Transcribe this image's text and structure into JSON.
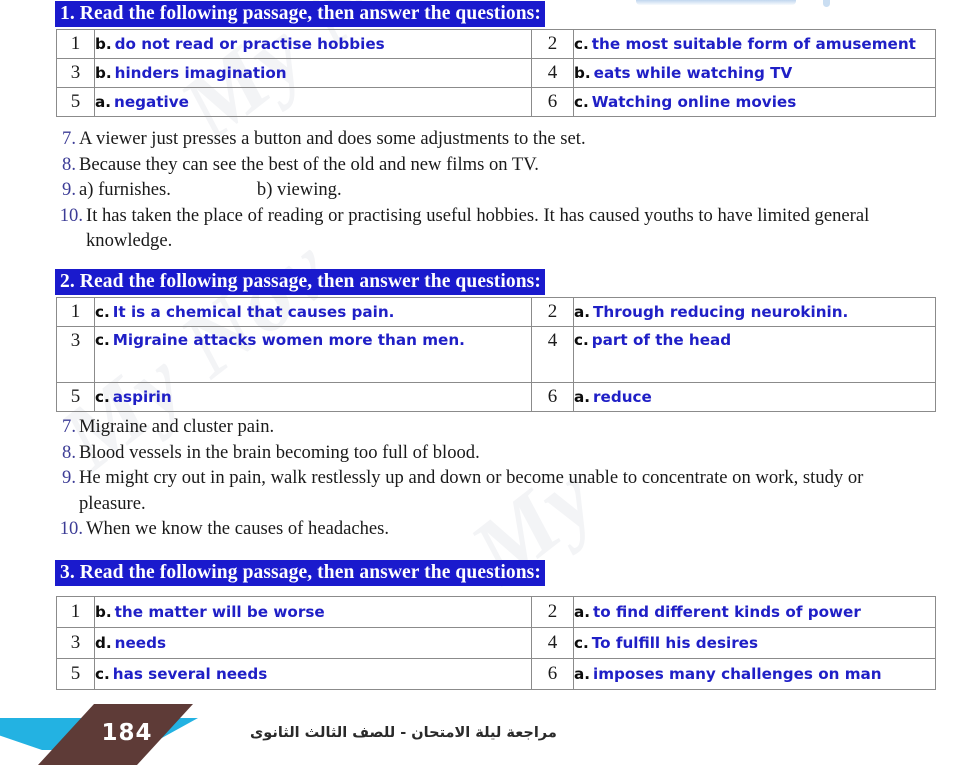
{
  "page": {
    "number": "184",
    "footer_arabic": "مراجعة ليلة الامتحان - للصف الثالث الثانوى",
    "accent_blue": "#1a1acd",
    "answer_blue": "#1f1fc6",
    "footer_cyan": "#23b2e2",
    "footer_brown": "#5e3b37",
    "table_border": "#8b8b8b"
  },
  "watermark": {
    "line1": "My Nov",
    "line2": "My Nov",
    "line3": "My"
  },
  "sections": [
    {
      "heading": "1. Read the following passage, then answer the questions:",
      "table": {
        "rows": [
          {
            "left_num": "1",
            "left_option": "b.",
            "left_text": "do not read or practise hobbies",
            "right_num": "2",
            "right_option": "c.",
            "right_text": "the most suitable form of amusement"
          },
          {
            "left_num": "3",
            "left_option": "b.",
            "left_text": "hinders imagination",
            "right_num": "4",
            "right_option": "b.",
            "right_text": "eats while watching TV"
          },
          {
            "left_num": "5",
            "left_option": "a.",
            "left_text": "negative",
            "right_num": "6",
            "right_option": "c.",
            "right_text": "Watching online movies"
          }
        ]
      },
      "written": [
        {
          "n": "7.",
          "text": "A viewer just presses a button and does some adjustments to the set."
        },
        {
          "n": "8.",
          "text": "Because they can see the best of the old and new films on TV."
        },
        {
          "n": "9.",
          "text": "a) furnishes.",
          "text2": "b) viewing."
        },
        {
          "n": "10.",
          "text": "It has taken the place of reading or practising useful hobbies. It has caused youths to have limited general knowledge."
        }
      ]
    },
    {
      "heading": "2. Read the following passage, then answer the questions:",
      "table": {
        "rows": [
          {
            "left_num": "1",
            "left_option": "c.",
            "left_text": "It is a chemical that causes pain.",
            "right_num": "2",
            "right_option": "a.",
            "right_text": "Through reducing neurokinin."
          },
          {
            "left_num": "3",
            "left_option": "c.",
            "left_text": "Migraine attacks women more than men.",
            "right_num": "4",
            "right_option": "c.",
            "right_text": "part of the head"
          },
          {
            "left_num": "5",
            "left_option": "c.",
            "left_text": "aspirin",
            "right_num": "6",
            "right_option": "a.",
            "right_text": "reduce"
          }
        ]
      },
      "written": [
        {
          "n": "7.",
          "text": "Migraine and cluster pain."
        },
        {
          "n": "8.",
          "text": "Blood vessels in the brain becoming too full of blood."
        },
        {
          "n": "9.",
          "text": "He might cry out in pain, walk restlessly up and down or become unable to concentrate on work, study or pleasure."
        },
        {
          "n": "10.",
          "text": "When we know the causes of headaches."
        }
      ]
    },
    {
      "heading": "3. Read the following passage, then answer the questions:",
      "table": {
        "rows": [
          {
            "left_num": "1",
            "left_option": "b.",
            "left_text": "the matter will be worse",
            "right_num": "2",
            "right_option": "a.",
            "right_text": "to find different kinds of power"
          },
          {
            "left_num": "3",
            "left_option": "d.",
            "left_text": "needs",
            "right_num": "4",
            "right_option": "c.",
            "right_text": "To fulfill his desires"
          },
          {
            "left_num": "5",
            "left_option": "c.",
            "left_text": "has several needs",
            "right_num": "6",
            "right_option": "a.",
            "right_text": "imposes many challenges on man"
          }
        ]
      },
      "written": []
    }
  ]
}
